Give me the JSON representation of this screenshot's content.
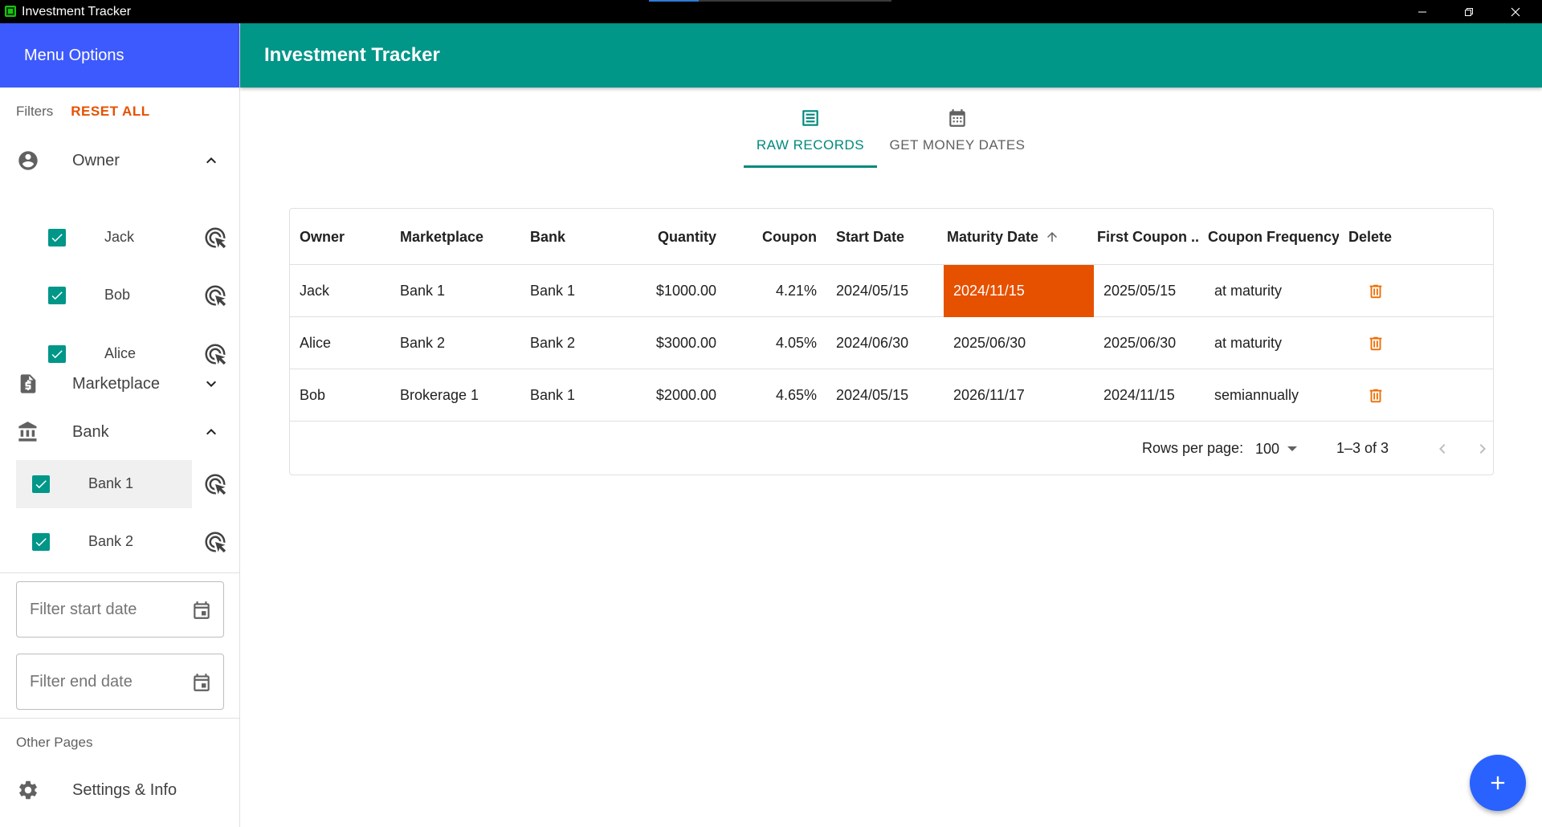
{
  "window": {
    "title": "Investment Tracker",
    "min_glyph": "—",
    "max_glyph": "❐",
    "close_glyph": "✕"
  },
  "sidebar": {
    "header": "Menu Options",
    "filters_label": "Filters",
    "reset_all": "RESET ALL",
    "sections": {
      "owner": {
        "label": "Owner",
        "icon": "account-circle-icon",
        "expanded": true
      },
      "marketplace": {
        "label": "Marketplace",
        "icon": "invoice-dollar-icon",
        "expanded": false
      },
      "bank": {
        "label": "Bank",
        "icon": "bank-icon",
        "expanded": true
      }
    },
    "owners": [
      {
        "label": "Jack",
        "checked": true
      },
      {
        "label": "Bob",
        "checked": true
      },
      {
        "label": "Alice",
        "checked": true
      }
    ],
    "banks": [
      {
        "label": "Bank 1",
        "checked": true
      },
      {
        "label": "Bank 2",
        "checked": true
      }
    ],
    "start_date_placeholder": "Filter start date",
    "end_date_placeholder": "Filter end date",
    "other_pages_label": "Other Pages",
    "settings_label": "Settings & Info"
  },
  "appbar": {
    "title": "Investment Tracker"
  },
  "tabs": [
    {
      "label": "RAW RECORDS",
      "icon": "list-alt-icon",
      "active": true
    },
    {
      "label": "GET MONEY DATES",
      "icon": "calendar-icon",
      "active": false
    }
  ],
  "table": {
    "columns": [
      "Owner",
      "Marketplace",
      "Bank",
      "Quantity",
      "Coupon",
      "Start Date",
      "Maturity Date",
      "First Coupon ...",
      "Coupon Frequency",
      "Delete"
    ],
    "sorted_column": "Maturity Date",
    "sort_direction": "ascending",
    "rows": [
      {
        "owner": "Jack",
        "marketplace": "Bank 1",
        "bank": "Bank 1",
        "quantity": "$1000.00",
        "coupon": "4.21%",
        "start_date": "2024/05/15",
        "maturity_date": "2024/11/15",
        "first_coupon": "2025/05/15",
        "coupon_frequency": "at maturity"
      },
      {
        "owner": "Alice",
        "marketplace": "Bank 2",
        "bank": "Bank 2",
        "quantity": "$3000.00",
        "coupon": "4.05%",
        "start_date": "2024/06/30",
        "maturity_date": "2025/06/30",
        "first_coupon": "2025/06/30",
        "coupon_frequency": "at maturity"
      },
      {
        "owner": "Bob",
        "marketplace": "Brokerage 1",
        "bank": "Bank 1",
        "quantity": "$2000.00",
        "coupon": "4.65%",
        "start_date": "2024/05/15",
        "maturity_date": "2026/11/17",
        "first_coupon": "2024/11/15",
        "coupon_frequency": "semiannually"
      }
    ],
    "selected_cell": {
      "row": 0,
      "column": "Maturity Date"
    },
    "pagination": {
      "rows_per_page_label": "Rows per page:",
      "rows_per_page": "100",
      "range": "1–3 of 3"
    }
  },
  "colors": {
    "sidebar_header": "#3d5afe",
    "appbar": "#009688",
    "accent_teal": "#00897b",
    "reset_orange": "#e65100",
    "selected_cell": "#e65100",
    "delete_icon": "#ef6c00",
    "fab": "#2962ff"
  }
}
